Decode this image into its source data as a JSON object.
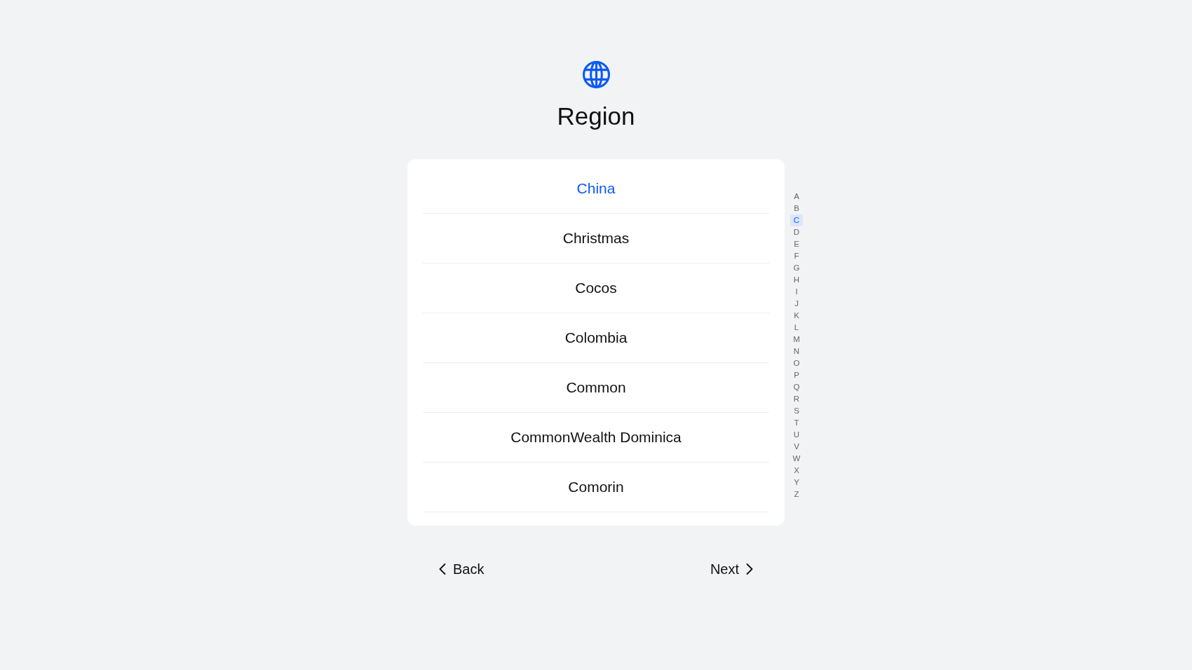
{
  "header": {
    "title": "Region"
  },
  "regions": [
    {
      "name": "China",
      "selected": true
    },
    {
      "name": "Christmas",
      "selected": false
    },
    {
      "name": "Cocos",
      "selected": false
    },
    {
      "name": "Colombia",
      "selected": false
    },
    {
      "name": "Common",
      "selected": false
    },
    {
      "name": "CommonWealth Dominica",
      "selected": false
    },
    {
      "name": "Comorin",
      "selected": false
    }
  ],
  "index": [
    {
      "letter": "A",
      "selected": false
    },
    {
      "letter": "B",
      "selected": false
    },
    {
      "letter": "C",
      "selected": true
    },
    {
      "letter": "D",
      "selected": false
    },
    {
      "letter": "E",
      "selected": false
    },
    {
      "letter": "F",
      "selected": false
    },
    {
      "letter": "G",
      "selected": false
    },
    {
      "letter": "H",
      "selected": false
    },
    {
      "letter": "I",
      "selected": false
    },
    {
      "letter": "J",
      "selected": false
    },
    {
      "letter": "K",
      "selected": false
    },
    {
      "letter": "L",
      "selected": false
    },
    {
      "letter": "M",
      "selected": false
    },
    {
      "letter": "N",
      "selected": false
    },
    {
      "letter": "O",
      "selected": false
    },
    {
      "letter": "P",
      "selected": false
    },
    {
      "letter": "Q",
      "selected": false
    },
    {
      "letter": "R",
      "selected": false
    },
    {
      "letter": "S",
      "selected": false
    },
    {
      "letter": "T",
      "selected": false
    },
    {
      "letter": "U",
      "selected": false
    },
    {
      "letter": "V",
      "selected": false
    },
    {
      "letter": "W",
      "selected": false
    },
    {
      "letter": "X",
      "selected": false
    },
    {
      "letter": "Y",
      "selected": false
    },
    {
      "letter": "Z",
      "selected": false
    }
  ],
  "navigation": {
    "back": "Back",
    "next": "Next"
  }
}
